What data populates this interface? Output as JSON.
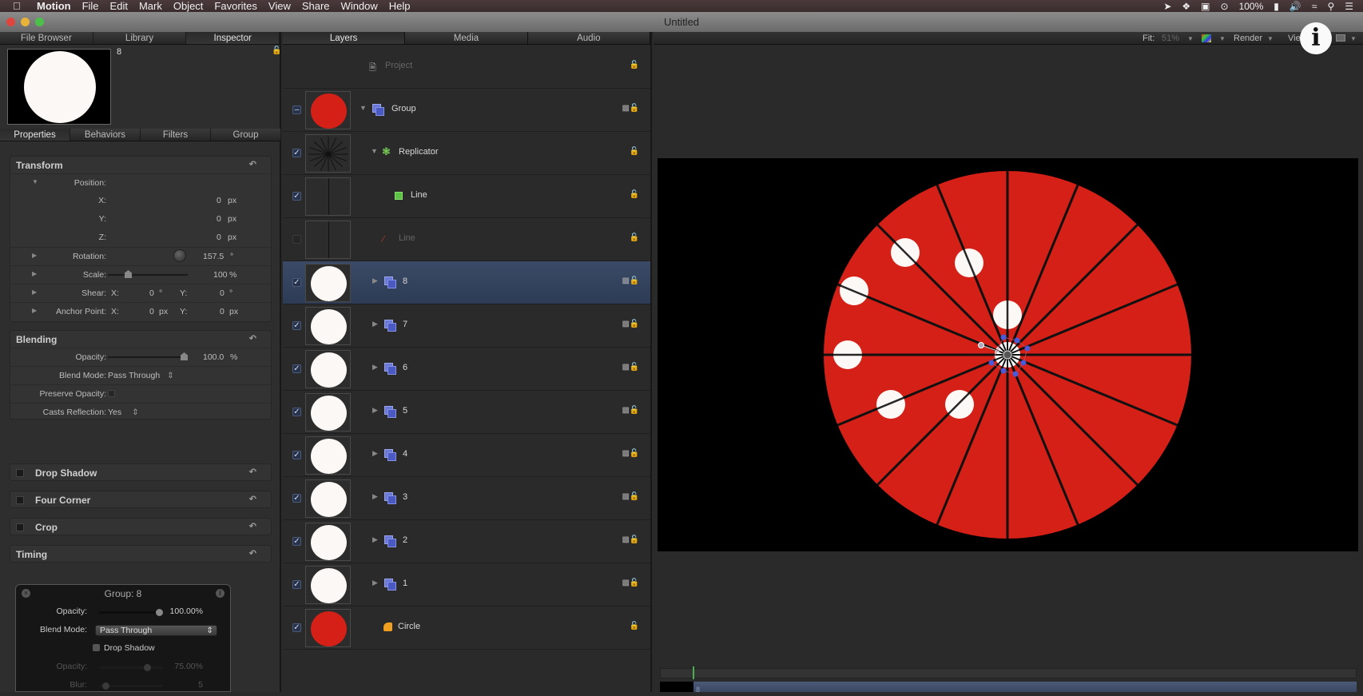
{
  "menubar": {
    "apple_icon": "apple-icon",
    "items": [
      "Motion",
      "File",
      "Edit",
      "Mark",
      "Object",
      "Favorites",
      "View",
      "Share",
      "Window",
      "Help"
    ],
    "status": {
      "battery": "100%",
      "icons": [
        "forward-icon",
        "dropbox-icon",
        "screen-record-icon",
        "bluetooth-icon",
        "battery-icon",
        "volume-icon",
        "wifi-icon",
        "search-icon",
        "list-icon"
      ]
    }
  },
  "window": {
    "title": "Untitled"
  },
  "inspector": {
    "tabs": [
      "File Browser",
      "Library",
      "Inspector"
    ],
    "active_tab": "Inspector",
    "object_name": "8",
    "subtabs": [
      "Properties",
      "Behaviors",
      "Filters",
      "Group"
    ],
    "active_subtab": "Properties",
    "transform": {
      "title": "Transform",
      "position_label": "Position:",
      "x_label": "X:",
      "x_value": "0",
      "x_unit": "px",
      "y_label": "Y:",
      "y_value": "0",
      "y_unit": "px",
      "z_label": "Z:",
      "z_value": "0",
      "z_unit": "px",
      "rotation_label": "Rotation:",
      "rotation_value": "157.5",
      "rotation_unit": "°",
      "scale_label": "Scale:",
      "scale_value": "100",
      "scale_unit": "%",
      "scale_fraction": 0.25,
      "shear_label": "Shear:",
      "shear_x_label": "X:",
      "shear_x": "0",
      "shear_x_unit": "°",
      "shear_y_label": "Y:",
      "shear_y": "0",
      "shear_y_unit": "°",
      "anchor_label": "Anchor Point:",
      "anchor_x_label": "X:",
      "anchor_x": "0",
      "anchor_x_unit": "px",
      "anchor_y_label": "Y:",
      "anchor_y": "0",
      "anchor_y_unit": "px"
    },
    "blending": {
      "title": "Blending",
      "opacity_label": "Opacity:",
      "opacity_value": "100.0",
      "opacity_unit": "%",
      "opacity_fraction": 1.0,
      "blend_mode_label": "Blend Mode:",
      "blend_mode": "Pass Through",
      "preserve_opacity_label": "Preserve Opacity:",
      "casts_reflection_label": "Casts Reflection:",
      "casts_reflection": "Yes"
    },
    "sections": [
      "Drop Shadow",
      "Four Corner",
      "Crop",
      "Timing"
    ]
  },
  "hud": {
    "title": "Group: 8",
    "opacity_label": "Opacity:",
    "opacity_value": "100.00%",
    "opacity_fraction": 1.0,
    "blend_mode_label": "Blend Mode:",
    "blend_mode": "Pass Through",
    "drop_shadow_label": "Drop Shadow",
    "shadow_opacity_label": "Opacity:",
    "shadow_opacity_value": "75.00%",
    "shadow_opacity_fraction": 0.75,
    "blur_label": "Blur:",
    "blur_value": "5",
    "blur_fraction": 0.05
  },
  "layers": {
    "tabs": [
      "Layers",
      "Media",
      "Audio"
    ],
    "active_tab": "Layers",
    "rows": [
      {
        "name": "Project",
        "type": "project",
        "checked": null
      },
      {
        "name": "Group",
        "type": "group",
        "checked": "mixed",
        "expanded": true
      },
      {
        "name": "Replicator",
        "type": "replicator",
        "checked": true,
        "expanded": true
      },
      {
        "name": "Line",
        "type": "shape-green",
        "checked": true
      },
      {
        "name": "Line",
        "type": "line-disabled",
        "checked": false
      },
      {
        "name": "8",
        "type": "group",
        "checked": true,
        "selected": true
      },
      {
        "name": "7",
        "type": "group",
        "checked": true
      },
      {
        "name": "6",
        "type": "group",
        "checked": true
      },
      {
        "name": "5",
        "type": "group",
        "checked": true
      },
      {
        "name": "4",
        "type": "group",
        "checked": true
      },
      {
        "name": "3",
        "type": "group",
        "checked": true
      },
      {
        "name": "2",
        "type": "group",
        "checked": true
      },
      {
        "name": "1",
        "type": "group",
        "checked": true
      },
      {
        "name": "Circle",
        "type": "circle",
        "checked": true
      }
    ]
  },
  "viewer": {
    "fit_label": "Fit:",
    "fit_value": "51%",
    "render_label": "Render",
    "view_label": "View",
    "colors": {
      "wheel_red": "#d42017",
      "dot_white": "#fcf8f6",
      "handle_blue": "#4a5ad8"
    },
    "spokes": 16,
    "dots": 8
  },
  "timeline": {
    "clip_label": "8"
  }
}
